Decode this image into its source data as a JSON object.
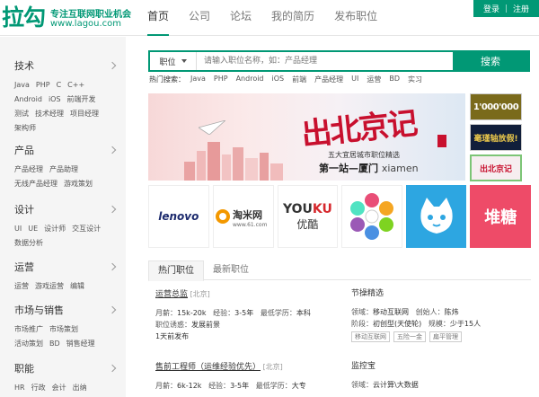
{
  "logo": {
    "mark": "拉勾",
    "tagline": "专注互联网职业机会",
    "url": "www.lagou.com"
  },
  "nav": [
    "首页",
    "公司",
    "论坛",
    "我的简历",
    "发布职位"
  ],
  "auth": {
    "login": "登录",
    "sep": "|",
    "register": "注册"
  },
  "sidebar": [
    {
      "title": "技术",
      "links": [
        "Java",
        "PHP",
        "C",
        "C++",
        "Android",
        "iOS",
        "前端开发",
        "测试",
        "技术经理",
        "项目经理",
        "架构师"
      ]
    },
    {
      "title": "产品",
      "links": [
        "产品经理",
        "产品助理",
        "无线产品经理",
        "游戏策划"
      ]
    },
    {
      "title": "设计",
      "links": [
        "UI",
        "UE",
        "设计师",
        "交互设计",
        "数据分析"
      ]
    },
    {
      "title": "运营",
      "links": [
        "运营",
        "游戏运营",
        "编辑"
      ]
    },
    {
      "title": "市场与销售",
      "links": [
        "市场推广",
        "市场策划",
        "活动策划",
        "BD",
        "销售经理"
      ]
    },
    {
      "title": "职能",
      "links": [
        "HR",
        "行政",
        "会计",
        "出纳"
      ]
    }
  ],
  "search": {
    "select": "职位",
    "placeholder": "请输入职位名称，如：产品经理",
    "button": "搜索"
  },
  "hot": {
    "label": "热门搜索：",
    "items": [
      "Java",
      "PHP",
      "Android",
      "iOS",
      "前端",
      "产品经理",
      "UI",
      "运营",
      "BD",
      "实习"
    ]
  },
  "banner": {
    "script": "出北京记",
    "sub1": "五大宜居城市职位精选",
    "sub2_main": "第一站—厦门",
    "sub2_en": "xiamen"
  },
  "thumbs": [
    "1'000'000",
    "毫瑾轴放假!",
    "出北京记"
  ],
  "companies": {
    "lenovo": "lenovo",
    "taomi_cn": "淘米网",
    "taomi_url": "www.61.com",
    "youku_a": "YOU",
    "youku_b": "KU",
    "youku_cn": "优酷",
    "duitang": "堆糖"
  },
  "tabs": [
    "热门职位",
    "最新职位"
  ],
  "jobs": [
    {
      "title": "运营总监",
      "city": "[北京]",
      "salary_label": "月薪：",
      "salary": "15k-20k",
      "exp_label": "经验：",
      "exp": "3-5年",
      "edu_label": "最低学历：",
      "edu": "本科",
      "lure_label": "职位诱惑：",
      "lure": "发展前景",
      "time": "1天前发布"
    },
    {
      "title": "售前工程师（运维经验优先）",
      "city": "[北京]",
      "salary_label": "月薪：",
      "salary": "6k-12k",
      "exp_label": "经验：",
      "exp": "3-5年",
      "edu_label": "最低学历：",
      "edu": "大专"
    }
  ],
  "company_cards": [
    {
      "name": "节操精选",
      "field_label": "领域：",
      "field": "移动互联网",
      "founder_label": "创始人：",
      "founder": "陈炜",
      "stage_label": "阶段：",
      "stage": "初创型(天使轮)",
      "size_label": "规模：",
      "size": "少于15人",
      "tags": [
        "移动互联网",
        "五险一金",
        "扁平管理"
      ]
    },
    {
      "name": "监控宝",
      "field_label": "领域：",
      "field": "云计算\\大数据"
    }
  ]
}
